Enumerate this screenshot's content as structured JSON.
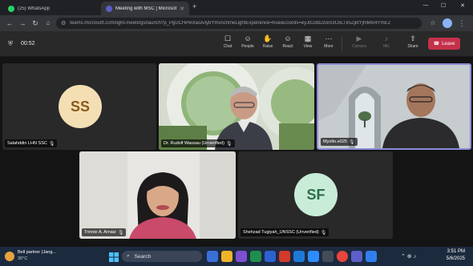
{
  "browser": {
    "tabs": [
      {
        "title": "(25) WhatsApp",
        "favicon_color": "#25d366",
        "active": false
      },
      {
        "title": "Meeting with MSC | Microsoft Teams",
        "favicon_color": "#5b5fc7",
        "active": true
      }
    ],
    "new_tab": "+",
    "window_controls": {
      "minimize": "—",
      "maximize": "☐",
      "close": "✕"
    },
    "url": "teams.microsoft.com/light-meetings/launch?p_PgUCHPk0rasA/lybYmsnchmeLightExperience=true&coords=eyJtc2ddJzoiS3UxLTk5ZjktYjhlMi04YmE2",
    "nav": {
      "back": "←",
      "forward": "→",
      "reload": "↻"
    }
  },
  "teams": {
    "timer": "00:52",
    "toolbar": [
      {
        "label": "Chat",
        "icon": "chat-icon",
        "glyph": "☐"
      },
      {
        "label": "People",
        "icon": "people-icon",
        "glyph": "☺"
      },
      {
        "label": "Raise",
        "icon": "raise-hand-icon",
        "glyph": "✋"
      },
      {
        "label": "React",
        "icon": "react-icon",
        "glyph": "☺"
      },
      {
        "label": "View",
        "icon": "view-icon",
        "glyph": "▦"
      },
      {
        "label": "More",
        "icon": "more-icon",
        "glyph": "⋯"
      }
    ],
    "toolbar_media": [
      {
        "label": "Camera",
        "icon": "camera-icon",
        "glyph": "▶"
      },
      {
        "label": "Mic",
        "icon": "mic-icon",
        "glyph": "♪"
      },
      {
        "label": "Share",
        "icon": "share-icon",
        "glyph": "⇧"
      }
    ],
    "leave_label": "Leave",
    "participants": [
      {
        "name": "Salahddin LHN SSC",
        "initials": "SS",
        "type": "avatar",
        "avatar_bg": "#f4dfb4",
        "avatar_fg": "#8a5a1a"
      },
      {
        "name": "Dr. Rudolf Wausau (Unverified)",
        "initials": "",
        "type": "video"
      },
      {
        "name": "Myolto.e025",
        "initials": "",
        "type": "video"
      },
      {
        "name": "Trinnie A. Arnaiz",
        "initials": "",
        "type": "video"
      },
      {
        "name": "Shehzad Tugiyah_UNSSC (Unverified)",
        "initials": "SF",
        "type": "avatar",
        "avatar_bg": "#c8ecd8",
        "avatar_fg": "#2c6e49"
      }
    ]
  },
  "taskbar": {
    "weather_temp": "30°C",
    "weather_text": "Bell partner (Jang...",
    "search_placeholder": "Search",
    "time": "3:51 PM",
    "date": "5/6/2025"
  }
}
